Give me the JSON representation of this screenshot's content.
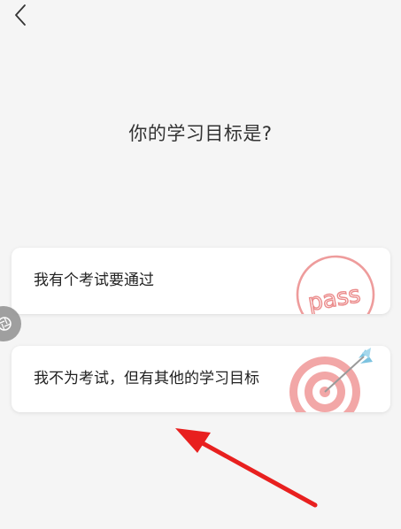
{
  "header": {
    "back_icon": "chevron-left-icon"
  },
  "page": {
    "title": "你的学习目标是?"
  },
  "options": [
    {
      "label": "我有个考试要通过",
      "art_text": "pass",
      "art_icon": "pass-stamp-icon"
    },
    {
      "label": "我不为考试，但有其他的学习目标",
      "art_icon": "target-arrow-icon"
    }
  ],
  "overlay": {
    "floating_icon": "aperture-icon",
    "annotation_icon": "red-arrow-icon"
  },
  "colors": {
    "background": "#f5f5f5",
    "card": "#ffffff",
    "text": "#222222",
    "art_red": "#eb8b8b",
    "art_blue": "#7cc3e0",
    "annotation_red": "#e8201f"
  }
}
